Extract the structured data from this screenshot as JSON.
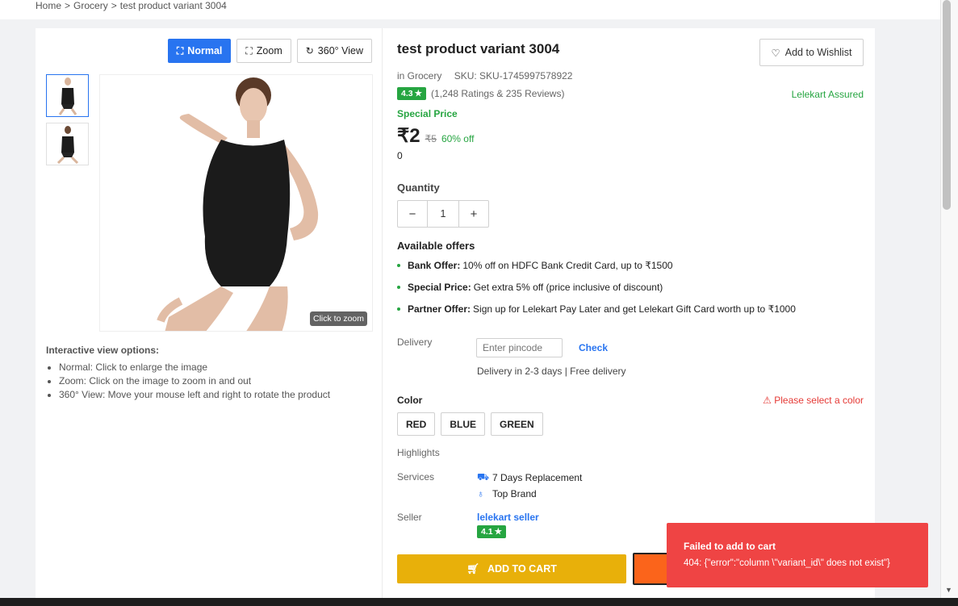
{
  "breadcrumb": {
    "home": "Home",
    "category": "Grocery",
    "current": "test product variant 3004",
    "sep1": ">",
    "sep2": ">"
  },
  "view_modes": {
    "normal": "Normal",
    "zoom": "Zoom",
    "view360": "360° View",
    "active": "normal"
  },
  "image": {
    "zoom_hint": "Click to zoom"
  },
  "view_options": {
    "title": "Interactive view options:",
    "items": [
      "Normal: Click to enlarge the image",
      "Zoom: Click on the image to zoom in and out",
      "360° View: Move your mouse left and right to rotate the product"
    ]
  },
  "product": {
    "title": "test product variant 3004",
    "category": "in Grocery",
    "sku": "SKU: SKU-1745997578922",
    "rating": "4.3",
    "rating_text": "(1,248 Ratings & 235 Reviews)",
    "assured": "Lelekart Assured",
    "special_label": "Special Price",
    "price": "₹2",
    "mrp": "₹5",
    "discount": "60% off",
    "extra_value": "0"
  },
  "quantity": {
    "label": "Quantity",
    "minus": "−",
    "value": "1",
    "plus": "+"
  },
  "offers": {
    "title": "Available offers",
    "items": [
      {
        "bold": "Bank Offer:",
        "text": "10% off on HDFC Bank Credit Card, up to ₹1500"
      },
      {
        "bold": "Special Price:",
        "text": "Get extra 5% off (price inclusive of discount)"
      },
      {
        "bold": "Partner Offer:",
        "text": "Sign up for Lelekart Pay Later and get Lelekart Gift Card worth up to ₹1000"
      }
    ]
  },
  "delivery": {
    "label": "Delivery",
    "placeholder": "Enter pincode",
    "check": "Check",
    "info": "Delivery in 2-3 days | Free delivery"
  },
  "color": {
    "label": "Color",
    "warning": "Please select a color",
    "options": [
      "RED",
      "BLUE",
      "GREEN"
    ]
  },
  "highlights": {
    "label": "Highlights"
  },
  "services": {
    "label": "Services",
    "items": [
      "7 Days Replacement",
      "Top Brand"
    ]
  },
  "seller": {
    "label": "Seller",
    "name": "lelekart seller",
    "rating": "4.1"
  },
  "actions": {
    "add_to_cart": "ADD TO CART"
  },
  "wishlist": {
    "label": "Add to Wishlist"
  },
  "toast": {
    "title": "Failed to add to cart",
    "message": "404: {\"error\":\"column \\\"variant_id\\\" does not exist\"}"
  },
  "colors": {
    "primary": "#2874f0",
    "green": "#26a541",
    "cart": "#e8b00a",
    "buy": "#fb641b",
    "error": "#ef4444"
  }
}
